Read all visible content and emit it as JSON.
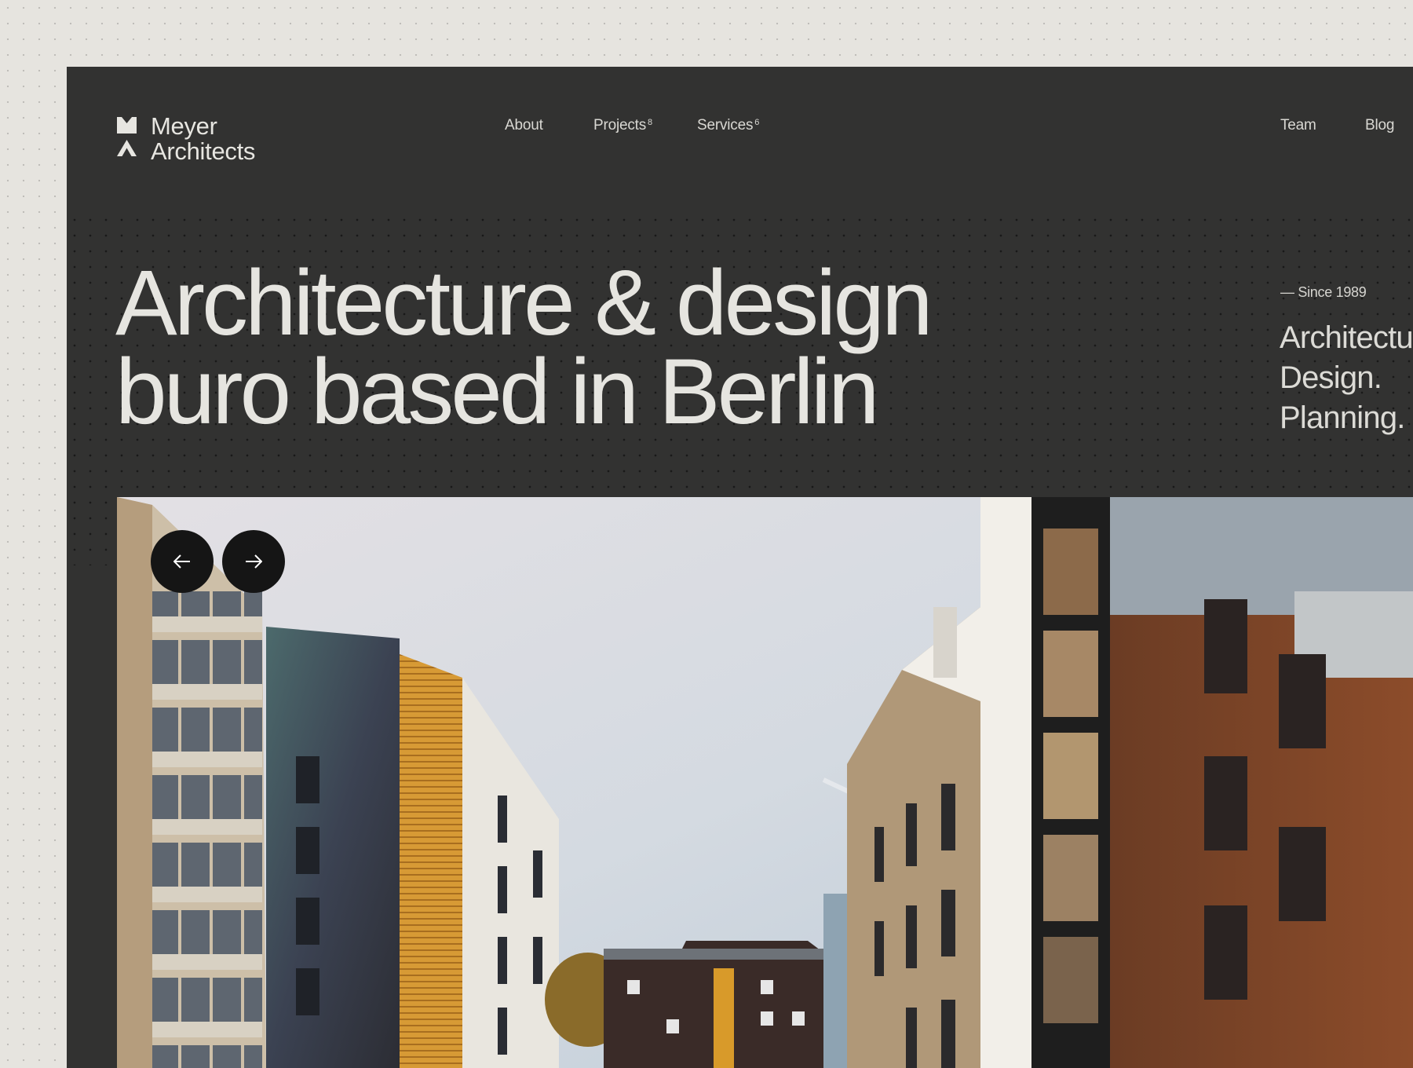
{
  "brand": {
    "line1": "Meyer",
    "line2": "Architects"
  },
  "nav": {
    "about": "About",
    "projects": "Projects",
    "projects_count": "8",
    "services": "Services",
    "services_count": "6",
    "team": "Team",
    "blog": "Blog"
  },
  "hero": {
    "headline_line1": "Architecture & design",
    "headline_line2": "buro based in Berlin",
    "since": "— Since 1989",
    "services": [
      "Architecture.",
      "Design.",
      "Planning."
    ]
  },
  "slider": {
    "prev_icon": "arrow-left-icon",
    "next_icon": "arrow-right-icon"
  },
  "colors": {
    "page_bg": "#e6e4df",
    "panel_bg": "#323231",
    "text_light": "#e6e5e0",
    "button_bg": "#151515"
  }
}
